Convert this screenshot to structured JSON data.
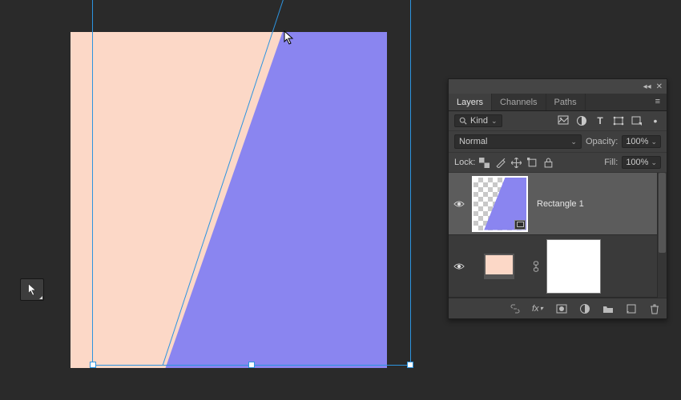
{
  "canvas": {
    "bg_color": "#fcd8c7",
    "shape_color": "#8a85f0",
    "selection_color": "#2d94df"
  },
  "tool": {
    "active": "direct-selection"
  },
  "panel": {
    "tabs": {
      "layers": "Layers",
      "channels": "Channels",
      "paths": "Paths"
    },
    "filter": {
      "kind_label": "Kind"
    },
    "blend": {
      "mode": "Normal",
      "opacity_label": "Opacity:",
      "opacity_value": "100%"
    },
    "lock": {
      "label": "Lock:",
      "fill_label": "Fill:",
      "fill_value": "100%"
    },
    "layers": [
      {
        "name": "Rectangle 1",
        "visible": true,
        "selected": true,
        "is_shape": true
      },
      {
        "name": "",
        "visible": true,
        "selected": false,
        "is_bg": true
      }
    ]
  }
}
